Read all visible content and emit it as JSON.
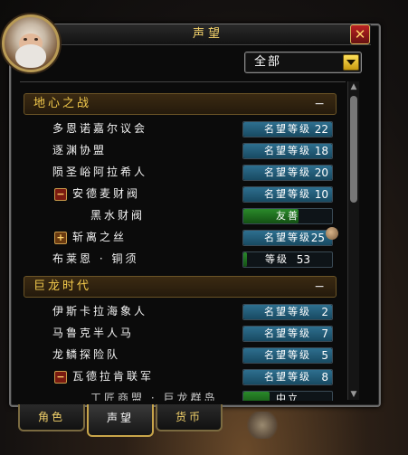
{
  "window": {
    "title": "声望",
    "close_label": "✕"
  },
  "filter": {
    "selected": "全部"
  },
  "sections": [
    {
      "label": "地心之战",
      "toggle": "−"
    },
    {
      "label": "巨龙时代",
      "toggle": "−"
    }
  ],
  "rows": [
    {
      "name": "多恩诺嘉尔议会",
      "bar": "名望等级",
      "num": "22",
      "fill": 0.0,
      "color": "blue"
    },
    {
      "name": "逐渊协盟",
      "bar": "名望等级",
      "num": "18",
      "fill": 0.0,
      "color": "blue"
    },
    {
      "name": "陨圣峪阿拉希人",
      "bar": "名望等级",
      "num": "20",
      "fill": 0.0,
      "color": "blue"
    },
    {
      "name": "安德麦财阀",
      "bar": "名望等级",
      "num": "10",
      "fill": 0.0,
      "color": "blue",
      "expand": "−"
    },
    {
      "name": "黑水财阀",
      "bar": "友善",
      "num": "",
      "fill": 0.62,
      "color": "green"
    },
    {
      "name": "斩离之丝",
      "bar": "名望等级",
      "num": "25",
      "fill": 0.0,
      "color": "blue",
      "expand": "+"
    },
    {
      "name": "布莱恩 · 铜须",
      "bar": "等级",
      "num": "53",
      "fill": 0.04,
      "color": "green"
    },
    {
      "name": "伊斯卡拉海象人",
      "bar": "名望等级",
      "num": "2",
      "fill": 0.0,
      "color": "blue"
    },
    {
      "name": "马鲁克半人马",
      "bar": "名望等级",
      "num": "7",
      "fill": 0.0,
      "color": "blue"
    },
    {
      "name": "龙鳞探险队",
      "bar": "名望等级",
      "num": "5",
      "fill": 0.0,
      "color": "blue"
    },
    {
      "name": "瓦德拉肯联军",
      "bar": "名望等级",
      "num": "8",
      "fill": 0.0,
      "color": "blue",
      "expand": "−"
    },
    {
      "name": "工匠商盟 · 巨龙群岛",
      "bar": "中立",
      "num": "",
      "fill": 0.3,
      "color": "green"
    }
  ],
  "tabs": [
    "角色",
    "声望",
    "货币"
  ],
  "colors": {
    "header_gold": "#f2c94c",
    "title_gold": "#f2d16a",
    "bar_blue": "#2e6f8f",
    "bar_green": "#2a8a2a"
  }
}
